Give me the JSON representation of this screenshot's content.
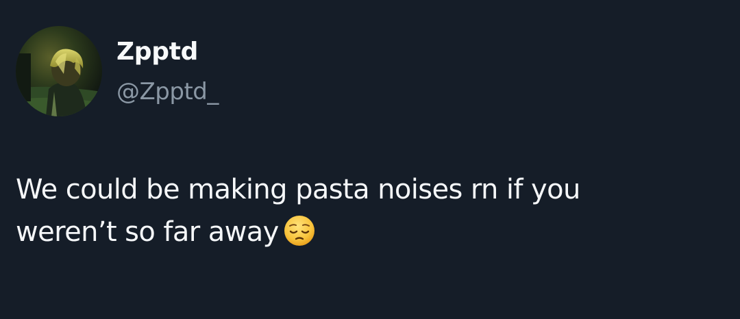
{
  "author": {
    "display_name": "Zpptd",
    "handle": "@Zpptd_"
  },
  "tweet": {
    "line1": "We could be making pasta noises rn if you",
    "line2": "weren’t so far away",
    "emoji": "pensive-face-emoji"
  },
  "colors": {
    "background": "#151d28",
    "primary_text": "#f5f7f9",
    "secondary_text": "#8b98a5"
  }
}
